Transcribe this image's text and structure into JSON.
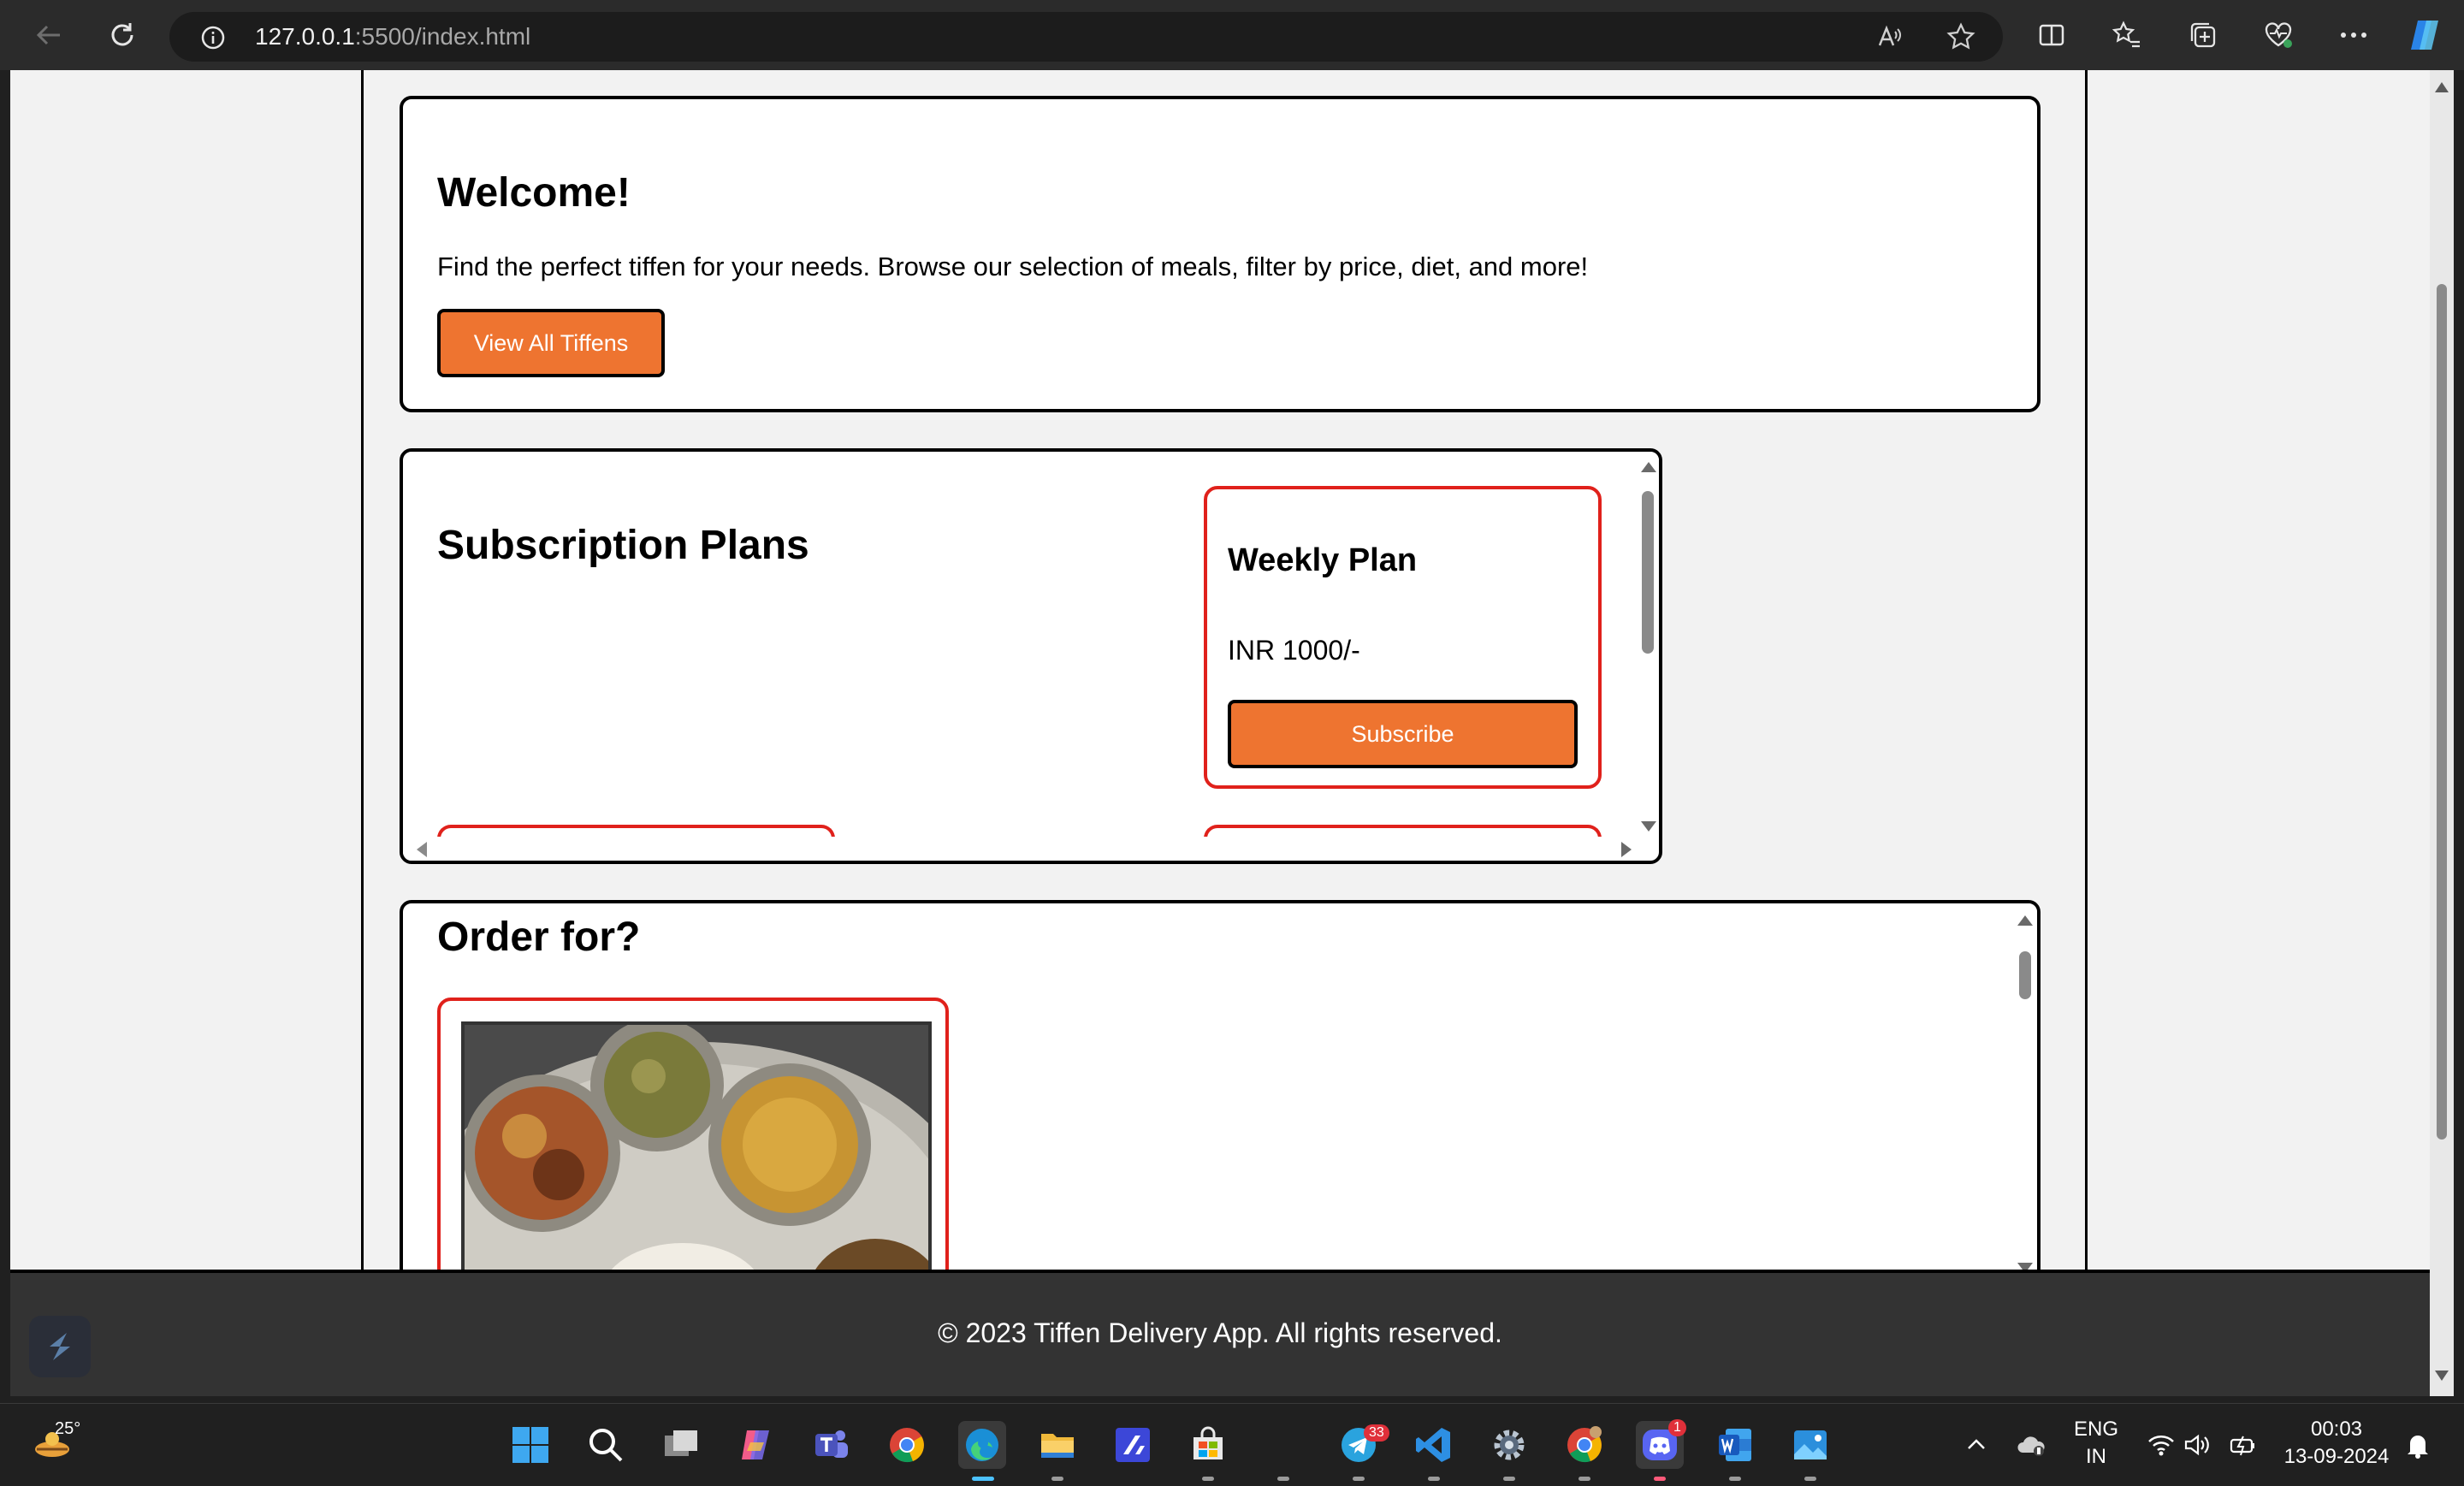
{
  "browser": {
    "url_host": "127.0.0.1",
    "url_rest": ":5500/index.html"
  },
  "welcome": {
    "title": "Welcome!",
    "text": "Find the perfect tiffen for your needs. Browse our selection of meals, filter by price, diet, and more!",
    "button": "View All Tiffens"
  },
  "plans": {
    "title": "Subscription Plans",
    "items": [
      {
        "name": "Weekly Plan",
        "price": "INR 1000/-",
        "button": "Subscribe"
      }
    ]
  },
  "order": {
    "title": "Order for?"
  },
  "footer": {
    "text": "© 2023 Tiffen Delivery App. All rights reserved."
  },
  "taskbar": {
    "weather_temp": "25°",
    "telegram_badge": "33",
    "discord_badge": "1",
    "lang_line1": "ENG",
    "lang_line2": "IN",
    "time": "00:03",
    "date": "13-09-2024"
  },
  "colors": {
    "accent_orange": "#ee7430",
    "card_red_border": "#e0211b",
    "footer_bg": "#333333"
  }
}
